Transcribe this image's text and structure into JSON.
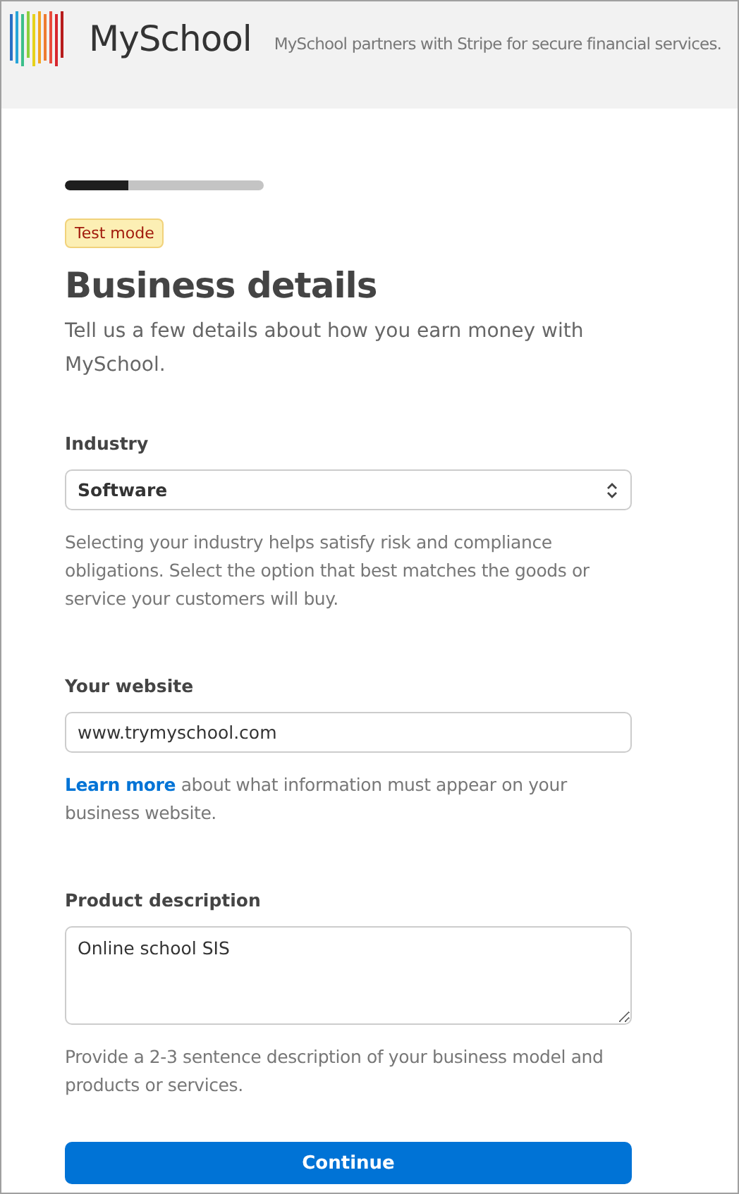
{
  "header": {
    "brand": "MySchool",
    "tagline": "MySchool partners with Stripe for secure financial services."
  },
  "progress": {
    "level": 0.32
  },
  "badge": "Test mode",
  "title": "Business details",
  "subtitle": "Tell us a few details about how you earn money with MySchool.",
  "fields": [
    {
      "kind": "select",
      "label": "Industry",
      "value": "Software",
      "hint": "Selecting your industry helps satisfy risk and compliance obligations. Select the option that best matches the goods or service your customers will buy."
    },
    {
      "kind": "input",
      "label": "Your website",
      "value": "www.trymyschool.com",
      "hint_link": "Learn more",
      "hint": " about what information must appear on your business website."
    },
    {
      "kind": "textarea",
      "label": "Product description",
      "value": "Online school SIS",
      "hint": "Provide a 2-3 sentence description of your business model and products or services."
    }
  ],
  "button": "Continue"
}
